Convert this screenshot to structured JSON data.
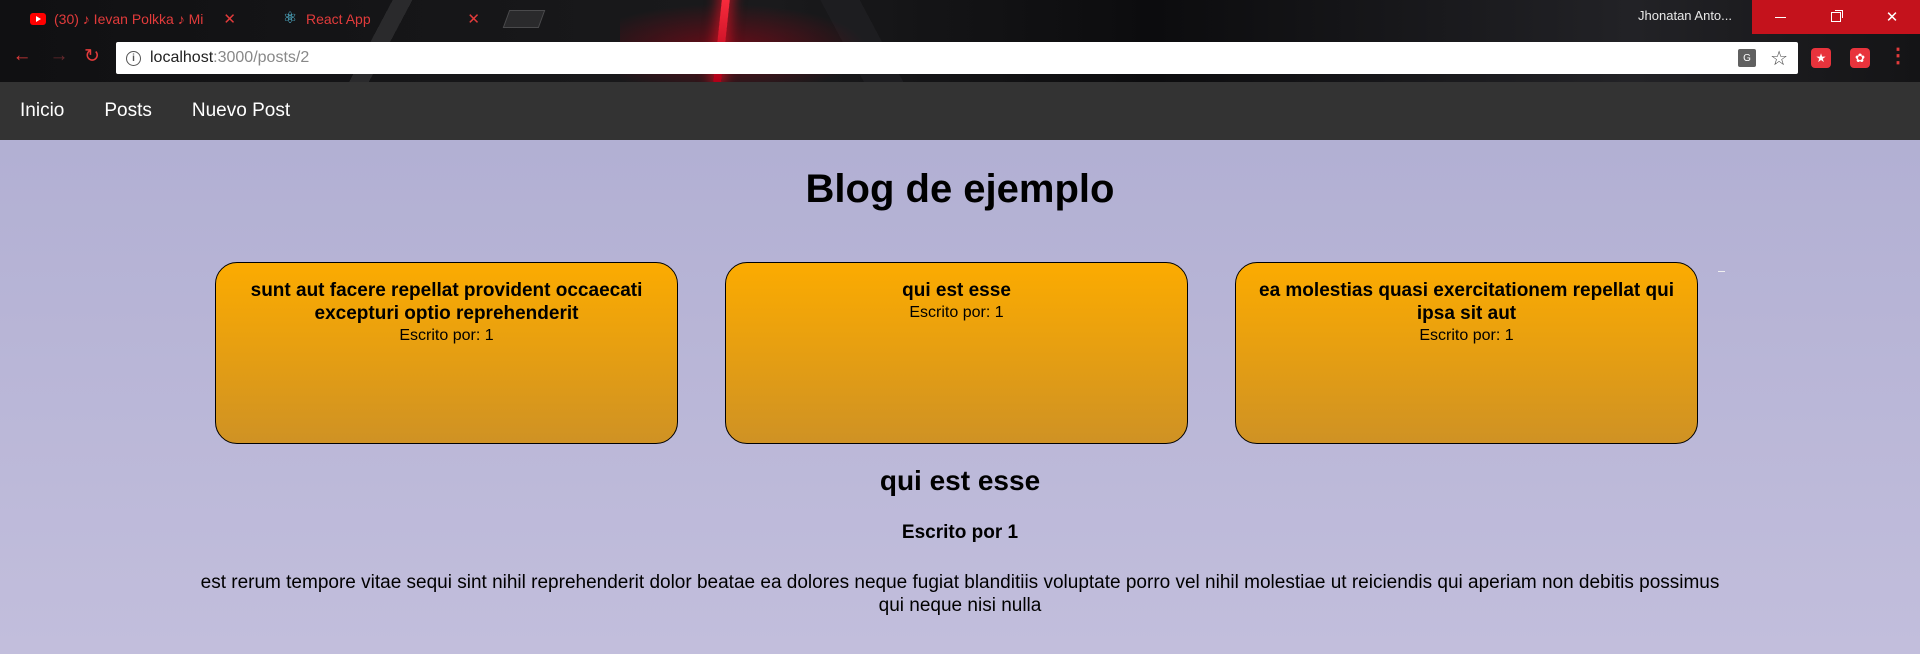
{
  "browser": {
    "tabs": [
      {
        "title": "(30) ♪ Ievan Polkka ♪ Mi",
        "icon": "youtube-icon",
        "active": false
      },
      {
        "title": "React App",
        "icon": "react-icon",
        "active": true
      }
    ],
    "profile_name": "Jhonatan Anto...",
    "url": {
      "host": "localhost",
      "path": ":3000/posts/2"
    },
    "accent_color": "#e23b3b",
    "window_button_color": "#c4121c"
  },
  "navbar": {
    "links": [
      "Inicio",
      "Posts",
      "Nuevo Post"
    ],
    "background": "#333333"
  },
  "blog": {
    "title": "Blog de ejemplo"
  },
  "cards": [
    {
      "title": "sunt aut facere repellat provident occaecati excepturi optio reprehenderit",
      "author_label": "Escrito por:",
      "author": "1"
    },
    {
      "title": "qui est esse",
      "author_label": "Escrito por:",
      "author": "1"
    },
    {
      "title": "ea molestias quasi exercitationem repellat qui ipsa sit aut",
      "author_label": "Escrito por:",
      "author": "1"
    }
  ],
  "card_colors": {
    "top": "#fcab00",
    "bottom": "#cf9224"
  },
  "post": {
    "title": "qui est esse",
    "author_line": "Escrito por 1",
    "body": "est rerum tempore vitae sequi sint nihil reprehenderit dolor beatae ea dolores neque fugiat blanditiis voluptate porro vel nihil molestiae ut reiciendis qui aperiam non debitis possimus qui neque nisi nulla"
  },
  "page_background": "#b3b0d3"
}
